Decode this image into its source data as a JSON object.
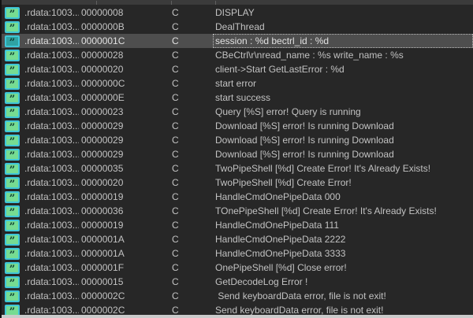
{
  "app": {
    "view_name": "strings-list",
    "icon_glyph": "”",
    "icon_semantic": "string-literal-icon"
  },
  "colors": {
    "background": "#272727",
    "row_text": "#c2c2c2",
    "selected_row_background": "#4e4e4e",
    "icon_border_cyan": "#3ec6d8",
    "icon_fill_green": "#76dc92",
    "icon_fill_selected_teal": "#2fa3a3",
    "header_strip": "#3b3b3b",
    "bottom_strip": "#cbcbcb"
  },
  "table": {
    "rows": [
      {
        "address": ".rdata:1003...",
        "length": "00000008",
        "type": "C",
        "string": "DISPLAY",
        "selected": false
      },
      {
        "address": ".rdata:1003...",
        "length": "0000000B",
        "type": "C",
        "string": "DealThread",
        "selected": false
      },
      {
        "address": ".rdata:1003...",
        "length": "0000001C",
        "type": "C",
        "string": "session : %d bectrl_id : %d",
        "selected": true
      },
      {
        "address": ".rdata:1003...",
        "length": "00000028",
        "type": "C",
        "string": "CBeCtrl\\r\\nread_name : %s write_name : %s",
        "selected": false
      },
      {
        "address": ".rdata:1003...",
        "length": "00000020",
        "type": "C",
        "string": "client->Start GetLastError : %d",
        "selected": false
      },
      {
        "address": ".rdata:1003...",
        "length": "0000000C",
        "type": "C",
        "string": "start error",
        "selected": false
      },
      {
        "address": ".rdata:1003...",
        "length": "0000000E",
        "type": "C",
        "string": "start success",
        "selected": false
      },
      {
        "address": ".rdata:1003...",
        "length": "00000023",
        "type": "C",
        "string": "Query [%S] error! Query is running",
        "selected": false
      },
      {
        "address": ".rdata:1003...",
        "length": "00000029",
        "type": "C",
        "string": "Download [%S] error! Is running Download",
        "selected": false
      },
      {
        "address": ".rdata:1003...",
        "length": "00000029",
        "type": "C",
        "string": "Download [%S] error! Is running Download",
        "selected": false
      },
      {
        "address": ".rdata:1003...",
        "length": "00000029",
        "type": "C",
        "string": "Download [%S] error! Is running Download",
        "selected": false
      },
      {
        "address": ".rdata:1003...",
        "length": "00000035",
        "type": "C",
        "string": "TwoPipeShell [%d] Create Error! It's Already Exists!",
        "selected": false
      },
      {
        "address": ".rdata:1003...",
        "length": "00000020",
        "type": "C",
        "string": "TwoPipeShell [%d] Create Error!",
        "selected": false
      },
      {
        "address": ".rdata:1003...",
        "length": "00000019",
        "type": "C",
        "string": "HandleCmdOnePipeData 000",
        "selected": false
      },
      {
        "address": ".rdata:1003...",
        "length": "00000036",
        "type": "C",
        "string": "TOnePipeShell [%d] Create Error! It's Already Exists!",
        "selected": false
      },
      {
        "address": ".rdata:1003...",
        "length": "00000019",
        "type": "C",
        "string": "HandleCmdOnePipeData 111",
        "selected": false
      },
      {
        "address": ".rdata:1003...",
        "length": "0000001A",
        "type": "C",
        "string": "HandleCmdOnePipeData 2222",
        "selected": false
      },
      {
        "address": ".rdata:1003...",
        "length": "0000001A",
        "type": "C",
        "string": "HandleCmdOnePipeData 3333",
        "selected": false
      },
      {
        "address": ".rdata:1003...",
        "length": "0000001F",
        "type": "C",
        "string": "OnePipeShell [%d] Close error!",
        "selected": false
      },
      {
        "address": ".rdata:1003...",
        "length": "00000015",
        "type": "C",
        "string": "GetDecodeLog Error !",
        "selected": false
      },
      {
        "address": ".rdata:1003...",
        "length": "0000002C",
        "type": "C",
        "string": " Send keyboardData error, file is not exit!",
        "selected": false
      },
      {
        "address": ".rdata:1003...",
        "length": "0000002C",
        "type": "C",
        "string": "Send keyboardData error, file is not exit!",
        "selected": false
      }
    ]
  }
}
